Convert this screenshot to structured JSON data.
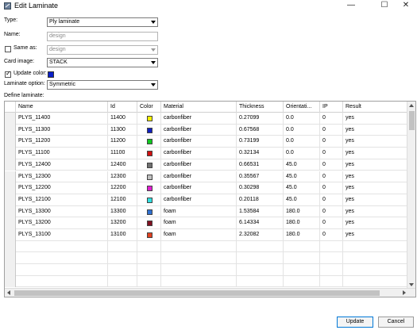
{
  "window": {
    "title": "Edit Laminate",
    "minimize_glyph": "—",
    "maximize_glyph": "☐",
    "close_glyph": "✕"
  },
  "form": {
    "type_label": "Type:",
    "type_value": "Ply laminate",
    "name_label": "Name:",
    "name_value": "design",
    "same_as_label": "Same as:",
    "same_as_value": "design",
    "same_as_checked": false,
    "card_image_label": "Card image:",
    "card_image_value": "STACK",
    "update_color_label": "Update color:",
    "update_color_checked": true,
    "update_color_swatch": "#0a1fc8",
    "laminate_option_label": "Laminate option:",
    "laminate_option_value": "Symmetric",
    "define_laminate_label": "Define laminate:"
  },
  "table": {
    "columns": [
      "Name",
      "Id",
      "Color",
      "Material",
      "Thickness",
      "Orientati...",
      "IP",
      "Result"
    ],
    "rows": [
      {
        "name": "PLYS_11400",
        "id": "11400",
        "color": "#f5f000",
        "material": "carbonfiber",
        "thickness": "0.27099",
        "orientation": "0.0",
        "ip": "0",
        "result": "yes"
      },
      {
        "name": "PLYS_11300",
        "id": "11300",
        "color": "#1020c0",
        "material": "carbonfiber",
        "thickness": "0.67568",
        "orientation": "0.0",
        "ip": "0",
        "result": "yes"
      },
      {
        "name": "PLYS_11200",
        "id": "11200",
        "color": "#10c820",
        "material": "carbonfiber",
        "thickness": "0.73199",
        "orientation": "0.0",
        "ip": "0",
        "result": "yes"
      },
      {
        "name": "PLYS_11100",
        "id": "11100",
        "color": "#d01010",
        "material": "carbonfiber",
        "thickness": "0.32134",
        "orientation": "0.0",
        "ip": "0",
        "result": "yes"
      },
      {
        "name": "PLYS_12400",
        "id": "12400",
        "color": "#707070",
        "material": "carbonfiber",
        "thickness": "0.66531",
        "orientation": "45.0",
        "ip": "0",
        "result": "yes"
      },
      {
        "name": "PLYS_12300",
        "id": "12300",
        "color": "#c0c0c0",
        "material": "carbonfiber",
        "thickness": "0.35567",
        "orientation": "45.0",
        "ip": "0",
        "result": "yes"
      },
      {
        "name": "PLYS_12200",
        "id": "12200",
        "color": "#e020d0",
        "material": "carbonfiber",
        "thickness": "0.30298",
        "orientation": "45.0",
        "ip": "0",
        "result": "yes"
      },
      {
        "name": "PLYS_12100",
        "id": "12100",
        "color": "#30e0e0",
        "material": "carbonfiber",
        "thickness": "0.20118",
        "orientation": "45.0",
        "ip": "0",
        "result": "yes"
      },
      {
        "name": "PLYS_13300",
        "id": "13300",
        "color": "#3070d0",
        "material": "foam",
        "thickness": "1.53584",
        "orientation": "180.0",
        "ip": "0",
        "result": "yes"
      },
      {
        "name": "PLYS_13200",
        "id": "13200",
        "color": "#801020",
        "material": "foam",
        "thickness": "6.14334",
        "orientation": "180.0",
        "ip": "0",
        "result": "yes"
      },
      {
        "name": "PLYS_13100",
        "id": "13100",
        "color": "#e04020",
        "material": "foam",
        "thickness": "2.32082",
        "orientation": "180.0",
        "ip": "0",
        "result": "yes"
      }
    ],
    "empty_rows": 4
  },
  "buttons": {
    "update": "Update",
    "cancel": "Cancel"
  }
}
